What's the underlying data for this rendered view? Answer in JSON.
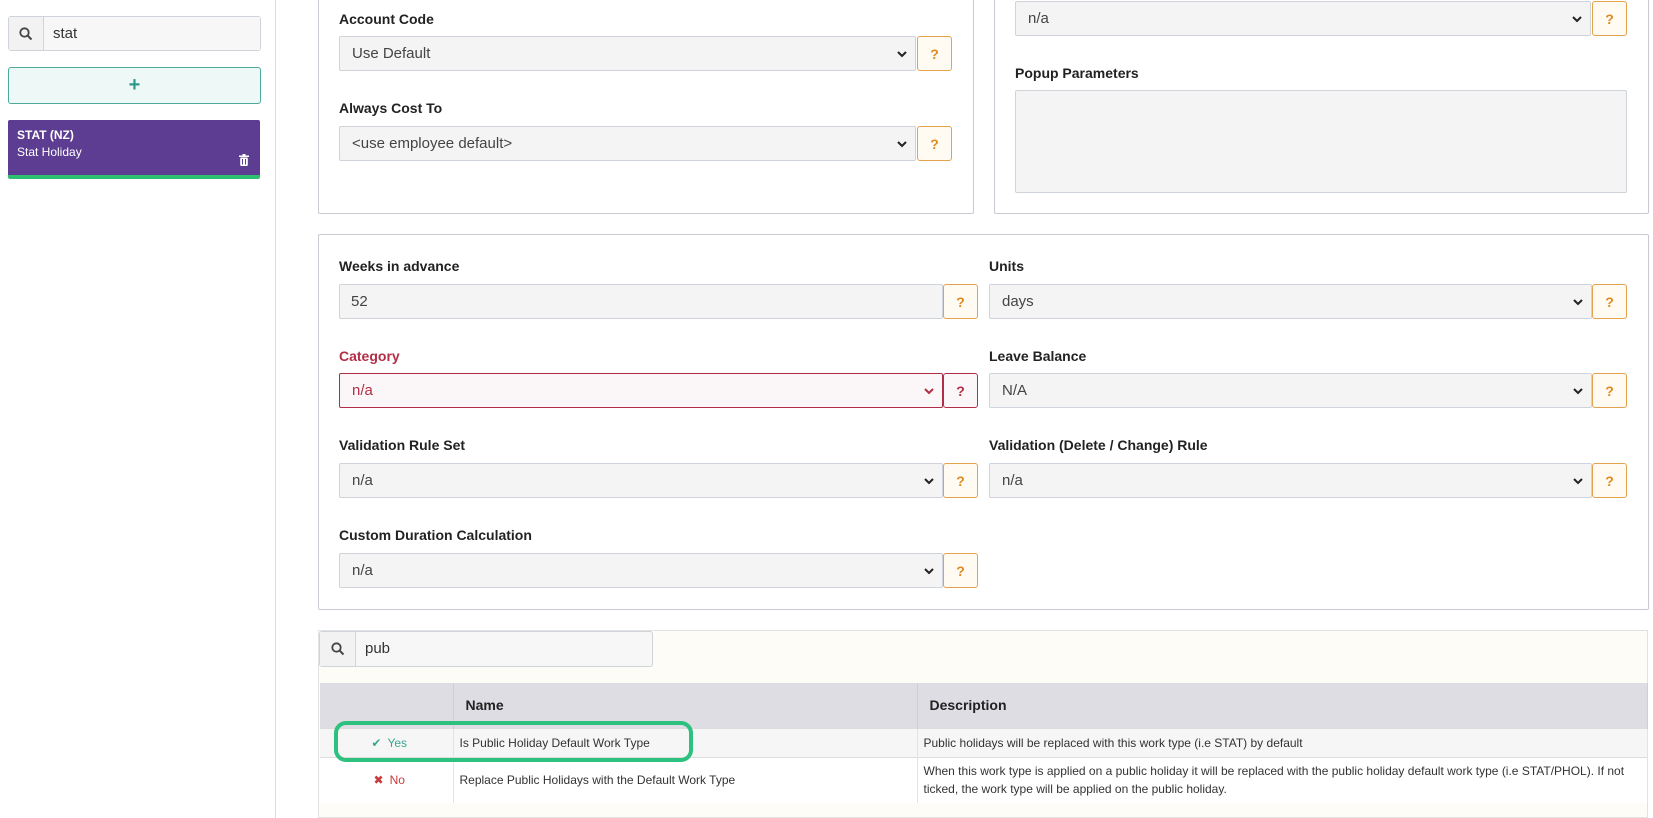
{
  "sidebar": {
    "search_value": "stat",
    "add_label": "+",
    "card": {
      "code": "STAT (NZ)",
      "name": "Stat Holiday"
    }
  },
  "top_left": {
    "account_code": {
      "label": "Account Code",
      "value": "Use Default",
      "help": "?"
    },
    "always_cost_to": {
      "label": "Always Cost To",
      "value": "<use employee default>",
      "help": "?"
    }
  },
  "top_right": {
    "first_select": {
      "value": "n/a",
      "help": "?"
    },
    "popup_parameters": {
      "label": "Popup Parameters"
    }
  },
  "settings": {
    "weeks_in_advance": {
      "label": "Weeks in advance",
      "value": "52",
      "help": "?"
    },
    "units": {
      "label": "Units",
      "value": "days",
      "help": "?"
    },
    "category": {
      "label": "Category",
      "value": "n/a",
      "help": "?"
    },
    "leave_balance": {
      "label": "Leave Balance",
      "value": "N/A",
      "help": "?"
    },
    "validation_rule_set": {
      "label": "Validation Rule Set",
      "value": "n/a",
      "help": "?"
    },
    "validation_delete_change": {
      "label": "Validation (Delete / Change) Rule",
      "value": "n/a",
      "help": "?"
    },
    "custom_duration": {
      "label": "Custom Duration Calculation",
      "value": "n/a",
      "help": "?"
    }
  },
  "grid": {
    "search_value": "pub",
    "columns": [
      "",
      "Name",
      "Description"
    ],
    "rows": [
      {
        "flag": "Yes",
        "name": "Is Public Holiday Default Work Type",
        "description": "Public holidays will be replaced with this work type (i.e STAT) by default"
      },
      {
        "flag": "No",
        "name": "Replace Public Holidays with the Default Work Type",
        "description": "When this work type is applied on a public holiday it will be replaced with the public holiday default work type (i.e STAT/PHOL). If not ticked, the work type will be applied on the public holiday."
      }
    ]
  },
  "colors": {
    "accent": "#5c3d91",
    "help": "#e08a1e",
    "required": "#b22e46",
    "highlight": "#2cc17e"
  }
}
